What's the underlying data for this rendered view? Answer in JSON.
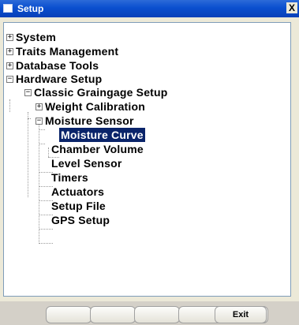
{
  "window": {
    "title": "Setup",
    "close_glyph": "X"
  },
  "tree": {
    "items": [
      {
        "label": "System"
      },
      {
        "label": "Traits Management"
      },
      {
        "label": "Database Tools"
      },
      {
        "label": "Hardware Setup"
      },
      {
        "label": "Classic Graingage Setup"
      },
      {
        "label": "Weight Calibration"
      },
      {
        "label": "Moisture Sensor"
      },
      {
        "label": "Moisture Curve"
      },
      {
        "label": "Chamber Volume"
      },
      {
        "label": "Level Sensor"
      },
      {
        "label": "Timers"
      },
      {
        "label": "Actuators"
      },
      {
        "label": "Setup File"
      },
      {
        "label": "GPS Setup"
      }
    ],
    "expander_collapsed": "+",
    "expander_expanded": "−",
    "selected": "Moisture Curve"
  },
  "buttons": [
    "",
    "",
    "",
    "",
    "",
    "Exit"
  ]
}
